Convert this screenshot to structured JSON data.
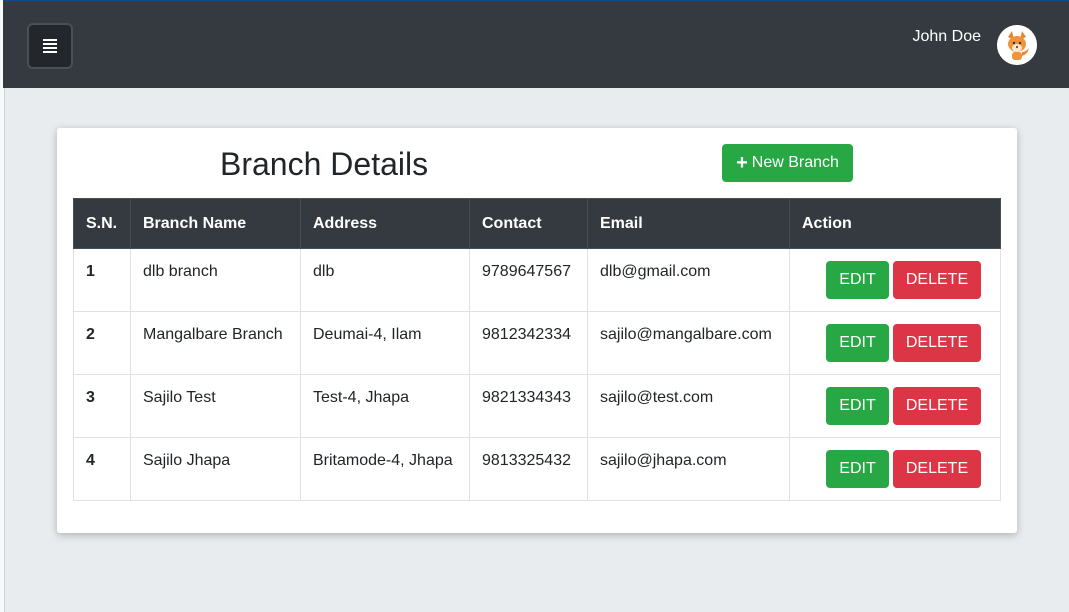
{
  "header": {
    "user_name": "John Doe",
    "menu_icon": "hamburger-menu-icon",
    "avatar_icon": "fox-avatar"
  },
  "main": {
    "title": "Branch Details",
    "new_button_label": "New Branch",
    "new_button_icon": "plus-icon"
  },
  "table": {
    "headers": [
      "S.N.",
      "Branch Name",
      "Address",
      "Contact",
      "Email",
      "Action"
    ],
    "rows": [
      {
        "sn": "1",
        "name": "dlb branch",
        "address": "dlb",
        "contact": "9789647567",
        "email": "dlb@gmail.com"
      },
      {
        "sn": "2",
        "name": "Mangalbare Branch",
        "address": "Deumai-4, Ilam",
        "contact": "9812342334",
        "email": "sajilo@mangalbare.com"
      },
      {
        "sn": "3",
        "name": "Sajilo Test",
        "address": "Test-4, Jhapa",
        "contact": "9821334343",
        "email": "sajilo@test.com"
      },
      {
        "sn": "4",
        "name": "Sajilo Jhapa",
        "address": "Britamode-4, Jhapa",
        "contact": "9813325432",
        "email": "sajilo@jhapa.com"
      }
    ],
    "edit_label": "EDIT",
    "delete_label": "DELETE"
  },
  "colors": {
    "topbar": "#343a40",
    "success": "#28a745",
    "danger": "#dc3545",
    "background": "#e9ecef"
  }
}
